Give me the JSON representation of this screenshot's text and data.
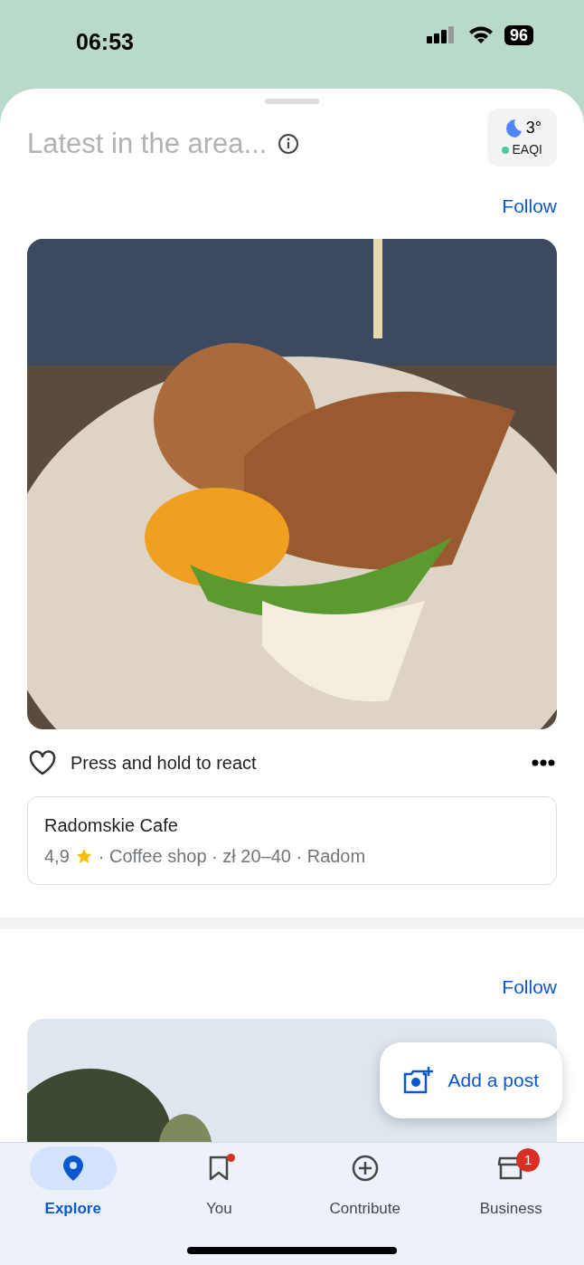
{
  "status_bar": {
    "time": "06:53",
    "battery": "96"
  },
  "header": {
    "title": "Latest in the area...",
    "weather": {
      "temperature": "3°",
      "aqi_label": "EAQI",
      "color": "#4cc9a0"
    }
  },
  "posts": [
    {
      "follow": "Follow",
      "kind": "food",
      "reaction": "Press and hold to react",
      "place": {
        "name": "Radomskie Cafe",
        "rating": "4,9",
        "details": "· Coffee shop · zł 20–40 · Radom"
      }
    },
    {
      "follow": "Follow",
      "kind": "sky"
    }
  ],
  "fab": {
    "label": "Add a post"
  },
  "nav": [
    {
      "kind": "pin",
      "label": "Explore",
      "selected": true,
      "dot": false
    },
    {
      "kind": "bookmark",
      "label": "You",
      "selected": false,
      "dot": true
    },
    {
      "kind": "plus",
      "label": "Contribute",
      "selected": false,
      "dot": false
    },
    {
      "kind": "store",
      "label": "Business",
      "selected": false,
      "dot": false,
      "badge": "1"
    }
  ]
}
